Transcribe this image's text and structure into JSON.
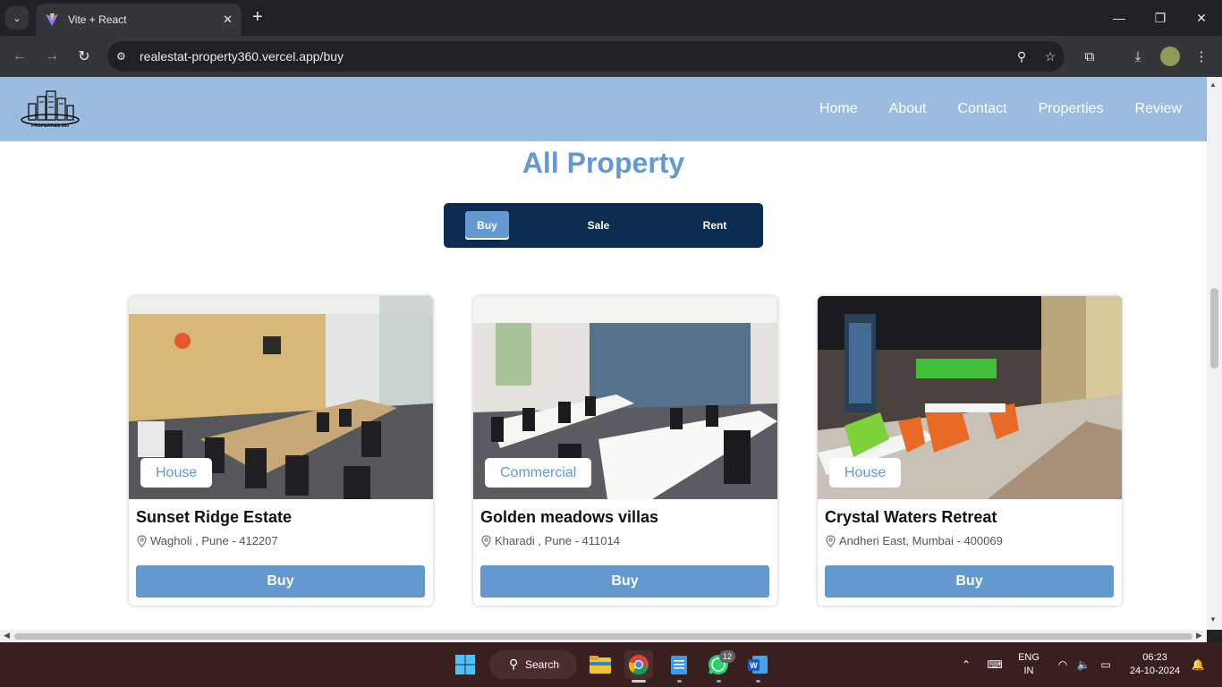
{
  "browser": {
    "tab_title": "Vite + React",
    "url": "realestat-property360.vercel.app/buy"
  },
  "site": {
    "logo_text": "PROPERTIES 360",
    "nav": [
      "Home",
      "About",
      "Contact",
      "Properties",
      "Review"
    ],
    "page_title": "All Property",
    "filters": [
      "Buy",
      "Sale",
      "Rent"
    ],
    "active_filter": "Buy"
  },
  "cards": [
    {
      "tag": "House",
      "title": "Sunset Ridge Estate",
      "location": "Wagholi , Pune - 412207",
      "button": "Buy"
    },
    {
      "tag": "Commercial",
      "title": "Golden meadows villas",
      "location": "Kharadi , Pune - 411014",
      "button": "Buy"
    },
    {
      "tag": "House",
      "title": "Crystal Waters Retreat",
      "location": "Andheri East, Mumbai - 400069",
      "button": "Buy"
    }
  ],
  "taskbar": {
    "search_label": "Search",
    "whatsapp_badge": "12",
    "lang_line1": "ENG",
    "lang_line2": "IN",
    "time": "06:23",
    "date": "24-10-2024"
  },
  "colors": {
    "header_bg": "#9bbcde",
    "accent": "#6499cf",
    "segment_bg": "#0c2d4f"
  }
}
